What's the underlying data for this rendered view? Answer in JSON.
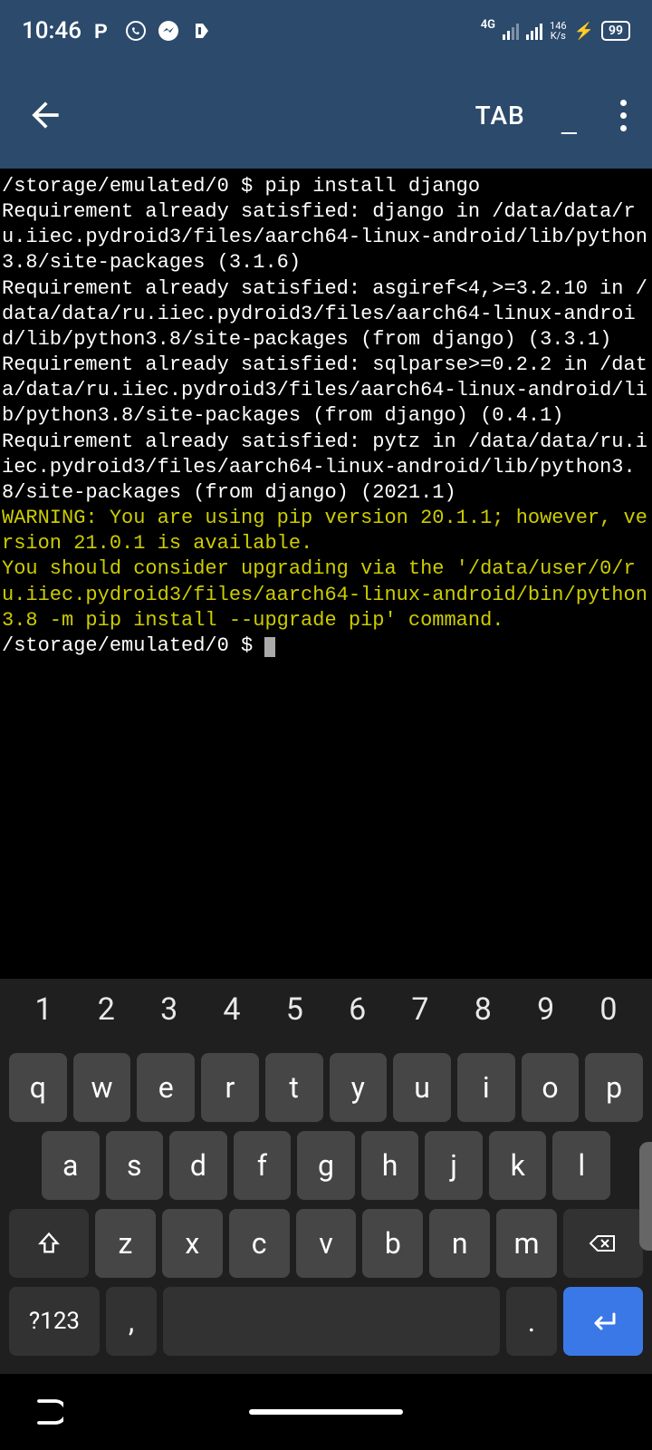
{
  "status": {
    "time": "10:46",
    "net_label": "4G",
    "speed_value": "146",
    "speed_unit": "K/s",
    "battery": "99"
  },
  "appbar": {
    "tab_label": "TAB"
  },
  "terminal": {
    "line1": "/storage/emulated/0 $ pip install django",
    "line2": "Requirement already satisfied: django in /data/data/ru.iiec.pydroid3/files/aarch64-linux-android/lib/python3.8/site-packages (3.1.6)",
    "line3": "Requirement already satisfied: asgiref<4,>=3.2.10 in /data/data/ru.iiec.pydroid3/files/aarch64-linux-android/lib/python3.8/site-packages (from django) (3.3.1)",
    "line4": "Requirement already satisfied: sqlparse>=0.2.2 in /data/data/ru.iiec.pydroid3/files/aarch64-linux-android/lib/python3.8/site-packages (from django) (0.4.1)",
    "line5": "Requirement already satisfied: pytz in /data/data/ru.iiec.pydroid3/files/aarch64-linux-android/lib/python3.8/site-packages (from django) (2021.1)",
    "warn1": "WARNING: You are using pip version 20.1.1; however, version 21.0.1 is available.",
    "warn2": "You should consider upgrading via the '/data/user/0/ru.iiec.pydroid3/files/aarch64-linux-android/bin/python3.8 -m pip install --upgrade pip' command.",
    "prompt": "/storage/emulated/0 $ "
  },
  "keyboard": {
    "numbers": [
      "1",
      "2",
      "3",
      "4",
      "5",
      "6",
      "7",
      "8",
      "9",
      "0"
    ],
    "row2": [
      "q",
      "w",
      "e",
      "r",
      "t",
      "y",
      "u",
      "i",
      "o",
      "p"
    ],
    "row3": [
      "a",
      "s",
      "d",
      "f",
      "g",
      "h",
      "j",
      "k",
      "l"
    ],
    "row4": [
      "z",
      "x",
      "c",
      "v",
      "b",
      "n",
      "m"
    ],
    "symbols_label": "?123",
    "comma": ",",
    "period": "."
  }
}
